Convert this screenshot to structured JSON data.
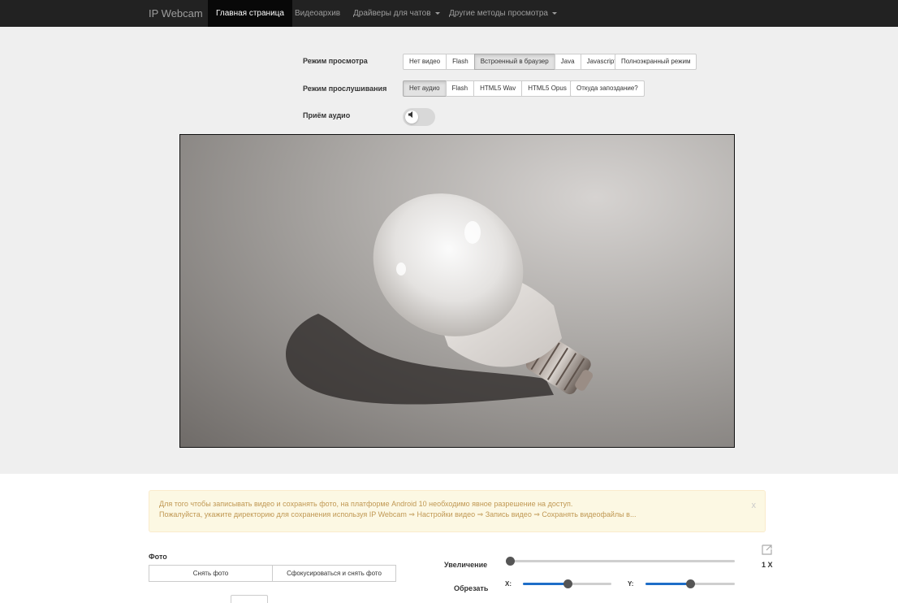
{
  "navbar": {
    "brand": "IP Webcam",
    "items": [
      {
        "label": "Главная страница",
        "active": true
      },
      {
        "label": "Видеоархив",
        "active": false
      },
      {
        "label": "Драйверы для чатов",
        "dropdown": true
      },
      {
        "label": "Другие методы просмотра",
        "dropdown": true
      }
    ]
  },
  "view_mode": {
    "label": "Режим просмотра",
    "options": [
      "Нет видео",
      "Flash",
      "Встроенный в браузер",
      "Java",
      "Javascript"
    ],
    "selected": "Встроенный в браузер",
    "fullscreen": "Полноэкранный режим"
  },
  "listen_mode": {
    "label": "Режим прослушивания",
    "options": [
      "Нет аудио",
      "Flash",
      "HTML5 Wav",
      "HTML5 Opus"
    ],
    "selected": "Нет аудио",
    "delay_help": "Откуда запоздание?"
  },
  "audio_receive": {
    "label": "Приём аудио",
    "enabled": false,
    "icon": "speaker-icon"
  },
  "video": {
    "subject": "light-bulb",
    "printed_text": "LED 2700K 470LM 5W E27 220-240V"
  },
  "alert": {
    "line1": "Для того чтобы записывать видео и сохранять фото, на платформе Android 10 необходимо явное разрешение на доступ.",
    "line2": "Пожалуйста, укажите директорию для сохранения используя IP Webcam ⇒ Настройки видео ⇒ Запись видео ⇒ Сохранять видеофайлы в...",
    "close": "x"
  },
  "photo": {
    "label": "Фото",
    "take_photo": "Снять фото",
    "focus_and_take": "Сфокусироваться и снять фото"
  },
  "zoom": {
    "label": "Увеличение",
    "value_text": "1 X",
    "level": 0
  },
  "crop": {
    "label": "Обрезать",
    "x_label": "X:",
    "y_label": "Y:",
    "x_level": 0.5,
    "y_level": 0.5
  },
  "colors": {
    "navbar_bg": "#222222",
    "alert_text": "#c09853",
    "slider_fill": "#1e6ec8"
  }
}
